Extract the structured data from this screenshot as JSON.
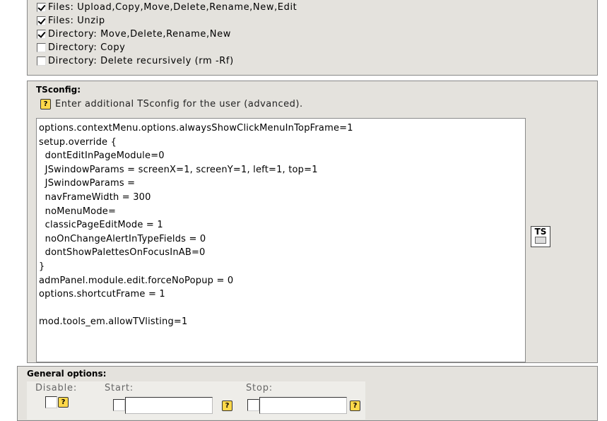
{
  "permissions": {
    "items": [
      {
        "label": "Files: Upload,Copy,Move,Delete,Rename,New,Edit",
        "checked": true
      },
      {
        "label": "Files: Unzip",
        "checked": true
      },
      {
        "label": "Directory: Move,Delete,Rename,New",
        "checked": true
      },
      {
        "label": "Directory: Copy",
        "checked": false
      },
      {
        "label": "Directory: Delete recursively (rm -Rf)",
        "checked": false
      }
    ]
  },
  "tsconfig": {
    "title": "TSconfig:",
    "description": "Enter additional TSconfig for the user (advanced).",
    "help_icon": "help-icon",
    "ts_icon_label": "TS",
    "lines": [
      "options.contextMenu.options.alwaysShowClickMenuInTopFrame=1",
      "setup.override {",
      "  dontEditInPageModule=0",
      "  JSwindowParams = screenX=1, screenY=1, left=1, top=1",
      "  JSwindowParams =",
      "  navFrameWidth = 300",
      "  noMenuMode=",
      "  classicPageEditMode = 1",
      "  noOnChangeAlertInTypeFields = 0",
      "  dontShowPalettesOnFocusInAB=0",
      "}",
      "admPanel.module.edit.forceNoPopup = 0",
      "options.shortcutFrame = 1",
      "",
      "mod.tools_em.allowTVlisting=1"
    ]
  },
  "general": {
    "title": "General options:",
    "disable_label": "Disable:",
    "start_label": "Start:",
    "stop_label": "Stop:",
    "start_value": "",
    "stop_value": ""
  }
}
